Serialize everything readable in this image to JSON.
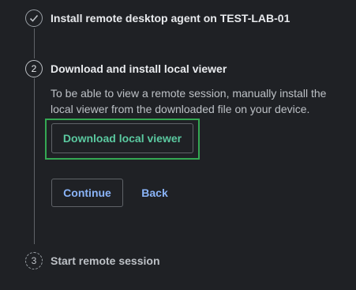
{
  "steps": [
    {
      "status": "completed",
      "title": "Install remote desktop agent on TEST-LAB-01"
    },
    {
      "status": "active",
      "number": "2",
      "title": "Download and install local viewer",
      "description": "To be able to view a remote session, manually install the local viewer from the downloaded file on your device.",
      "download_label": "Download local viewer"
    },
    {
      "status": "pending",
      "number": "3",
      "title": "Start remote session"
    }
  ],
  "actions": {
    "continue_label": "Continue",
    "back_label": "Back"
  },
  "colors": {
    "background": "#1f2125",
    "focus_ring": "#34a853",
    "primary_link": "#8ab4f8",
    "download_text": "#5bc9a0"
  }
}
